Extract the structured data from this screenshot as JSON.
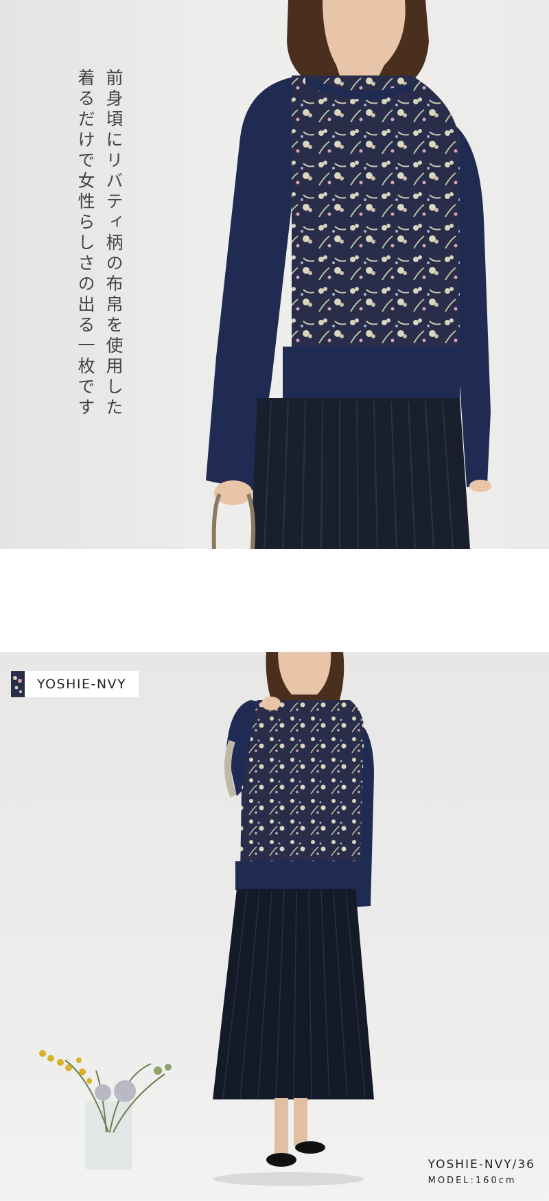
{
  "hero": {
    "copy_line_1": "前身頃にリバティ柄の布帛を使用した",
    "copy_line_2": "着るだけで女性らしさの出る一枚です"
  },
  "lookbook": {
    "color_tag": "YOSHIE-NVY",
    "product_code": "YOSHIE-NVY/36",
    "model_info": "MODEL:160cm"
  },
  "colors": {
    "navy": "#1f2b52",
    "print_cream": "#d8d2bc",
    "skirt": "#1a1f2e",
    "hair": "#4a2f1f",
    "skin": "#e8c4a8",
    "background": "#e9e9e7"
  }
}
